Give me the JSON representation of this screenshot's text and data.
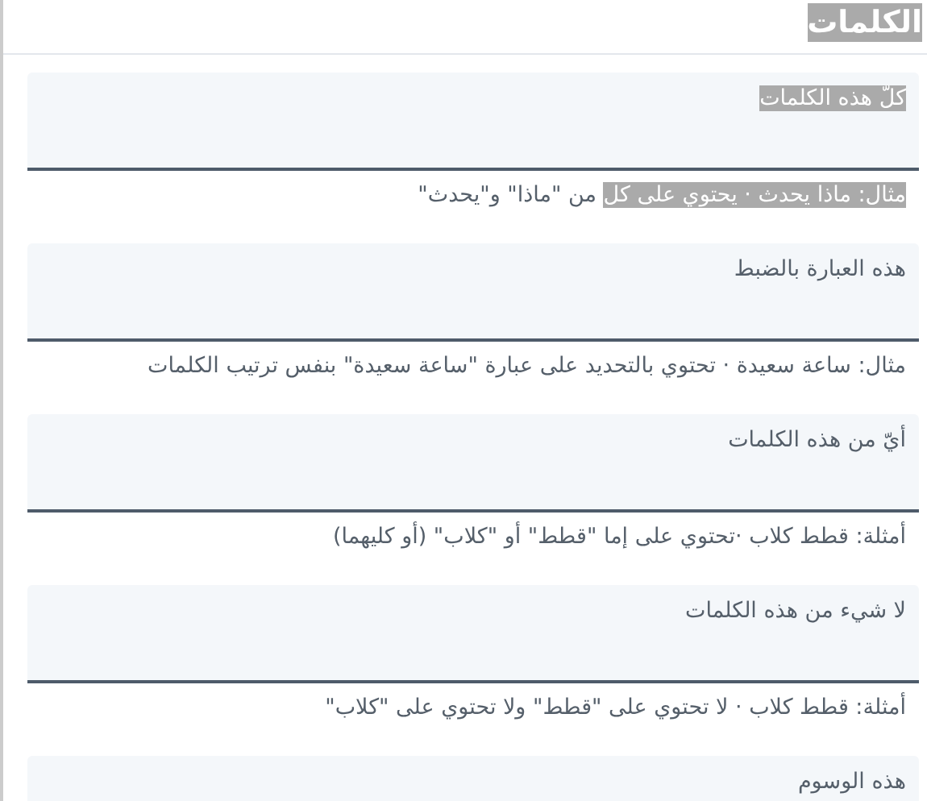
{
  "title": {
    "text": "الكلمات",
    "highlighted": true
  },
  "fields": [
    {
      "label": "كلّ هذه الكلمات",
      "highlighted": true,
      "example": [
        {
          "text": "مثال: ماذا يحدث · يحتوي على كل",
          "highlighted": true
        },
        {
          "text": " من \"ماذا\" و\"يحدث\"",
          "highlighted": false
        }
      ]
    },
    {
      "label": "هذه العبارة بالضبط",
      "highlighted": false,
      "example": [
        {
          "text": "مثال: ساعة سعيدة · تحتوي بالتحديد على عبارة \"ساعة سعيدة\" بنفس ترتيب الكلمات",
          "highlighted": false
        }
      ]
    },
    {
      "label": "أيّ من هذه الكلمات",
      "highlighted": false,
      "example": [
        {
          "text": "أمثلة: قطط كلاب ·تحتوي على إما \"قطط\" أو \"كلاب\" (أو كليهما)",
          "highlighted": false
        }
      ]
    },
    {
      "label": "لا شيء من هذه الكلمات",
      "highlighted": false,
      "example": [
        {
          "text": "أمثلة: قطط كلاب · لا تحتوي على \"قطط\" ولا تحتوي على \"كلاب\"",
          "highlighted": false
        }
      ]
    },
    {
      "label": "هذه الوسوم",
      "highlighted": false
    }
  ]
}
